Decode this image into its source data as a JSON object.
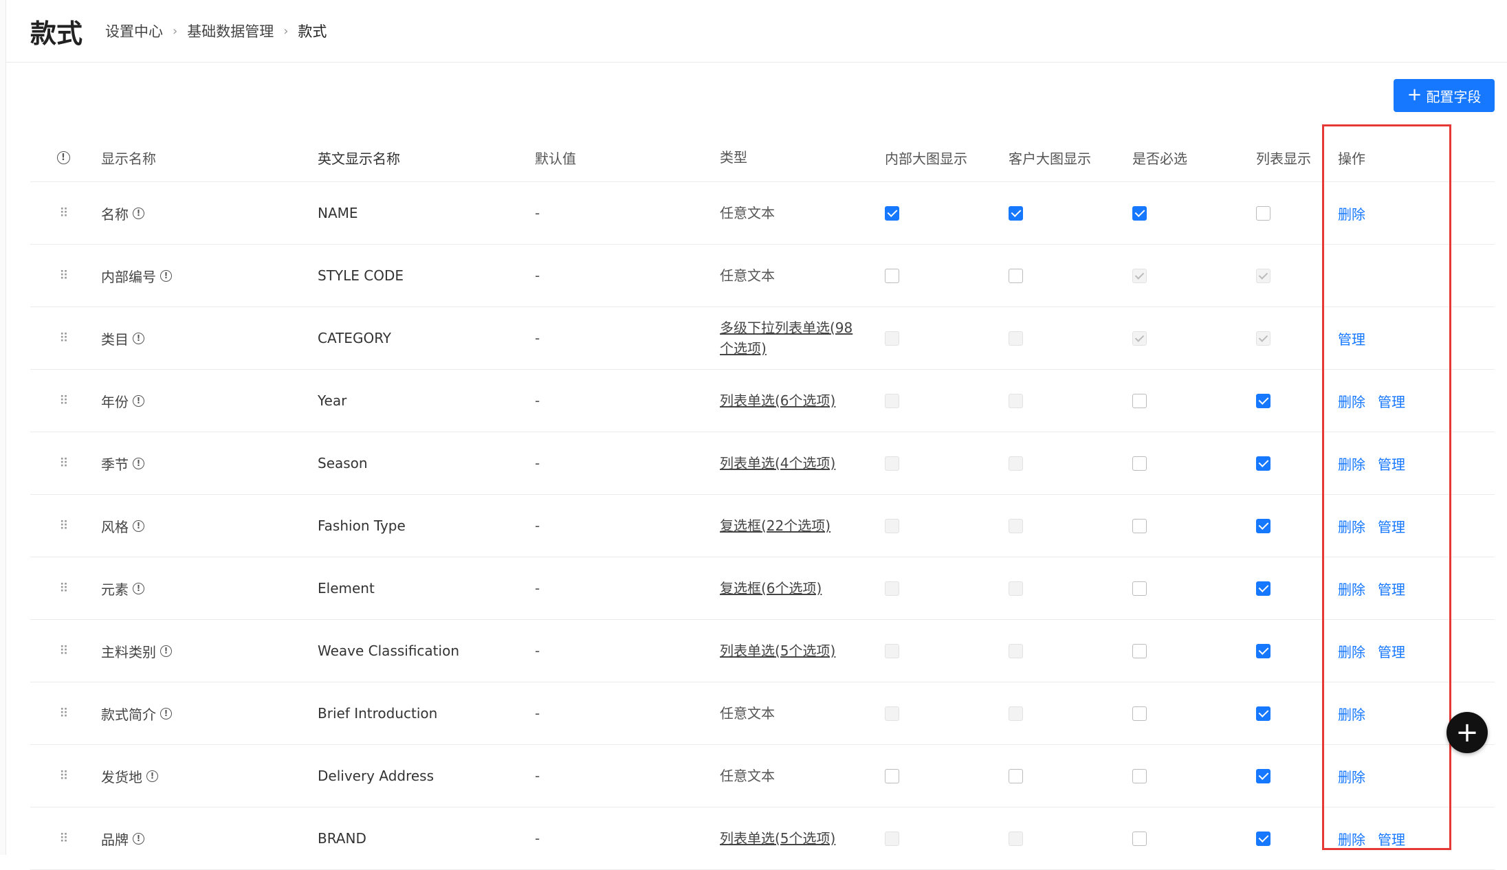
{
  "header": {
    "title": "款式",
    "breadcrumb": [
      "设置中心",
      "基础数据管理",
      "款式"
    ]
  },
  "toolbar": {
    "config_label": "配置字段"
  },
  "columns": {
    "name": "显示名称",
    "en_name": "英文显示名称",
    "default": "默认值",
    "type": "类型",
    "internal_image": "内部大图显示",
    "customer_image": "客户大图显示",
    "required": "是否必选",
    "list_display": "列表显示",
    "actions": "操作"
  },
  "rows": [
    {
      "name": "名称",
      "en": "NAME",
      "default": "-",
      "type": "任意文本",
      "type_link": false,
      "internal": "checked",
      "customer": "checked",
      "required": "checked",
      "list": "unchecked",
      "actions": [
        "删除"
      ]
    },
    {
      "name": "内部编号",
      "en": "STYLE CODE",
      "default": "-",
      "type": "任意文本",
      "type_link": false,
      "internal": "unchecked",
      "customer": "unchecked",
      "required": "disabled-checked",
      "list": "disabled-checked",
      "actions": []
    },
    {
      "name": "类目",
      "en": "CATEGORY",
      "default": "-",
      "type": "多级下拉列表单选(98个选项)",
      "type_link": true,
      "internal": "disabled",
      "customer": "disabled",
      "required": "disabled-checked",
      "list": "disabled-checked",
      "actions": [
        "管理"
      ]
    },
    {
      "name": "年份",
      "en": "Year",
      "default": "-",
      "type": "列表单选(6个选项)",
      "type_link": true,
      "internal": "disabled",
      "customer": "disabled",
      "required": "unchecked",
      "list": "checked",
      "actions": [
        "删除",
        "管理"
      ]
    },
    {
      "name": "季节",
      "en": "Season",
      "default": "-",
      "type": "列表单选(4个选项)",
      "type_link": true,
      "internal": "disabled",
      "customer": "disabled",
      "required": "unchecked",
      "list": "checked",
      "actions": [
        "删除",
        "管理"
      ]
    },
    {
      "name": "风格",
      "en": "Fashion Type",
      "default": "-",
      "type": "复选框(22个选项)",
      "type_link": true,
      "internal": "disabled",
      "customer": "disabled",
      "required": "unchecked",
      "list": "checked",
      "actions": [
        "删除",
        "管理"
      ]
    },
    {
      "name": "元素",
      "en": "Element",
      "default": "-",
      "type": "复选框(6个选项)",
      "type_link": true,
      "internal": "disabled",
      "customer": "disabled",
      "required": "unchecked",
      "list": "checked",
      "actions": [
        "删除",
        "管理"
      ]
    },
    {
      "name": "主料类别",
      "en": "Weave Classification",
      "default": "-",
      "type": "列表单选(5个选项)",
      "type_link": true,
      "internal": "disabled",
      "customer": "disabled",
      "required": "unchecked",
      "list": "checked",
      "actions": [
        "删除",
        "管理"
      ]
    },
    {
      "name": "款式简介",
      "en": "Brief Introduction",
      "default": "-",
      "type": "任意文本",
      "type_link": false,
      "internal": "disabled",
      "customer": "disabled",
      "required": "unchecked",
      "list": "checked",
      "actions": [
        "删除"
      ]
    },
    {
      "name": "发货地",
      "en": "Delivery Address",
      "default": "-",
      "type": "任意文本",
      "type_link": false,
      "internal": "unchecked",
      "customer": "unchecked",
      "required": "unchecked",
      "list": "checked",
      "actions": [
        "删除"
      ]
    },
    {
      "name": "品牌",
      "en": "BRAND",
      "default": "-",
      "type": "列表单选(5个选项)",
      "type_link": true,
      "internal": "disabled",
      "customer": "disabled",
      "required": "unchecked",
      "list": "checked",
      "actions": [
        "删除",
        "管理"
      ]
    }
  ],
  "fab": {
    "icon": "plus-icon",
    "label": "+"
  },
  "colors": {
    "primary": "#1677ff",
    "highlight": "#e53935"
  }
}
